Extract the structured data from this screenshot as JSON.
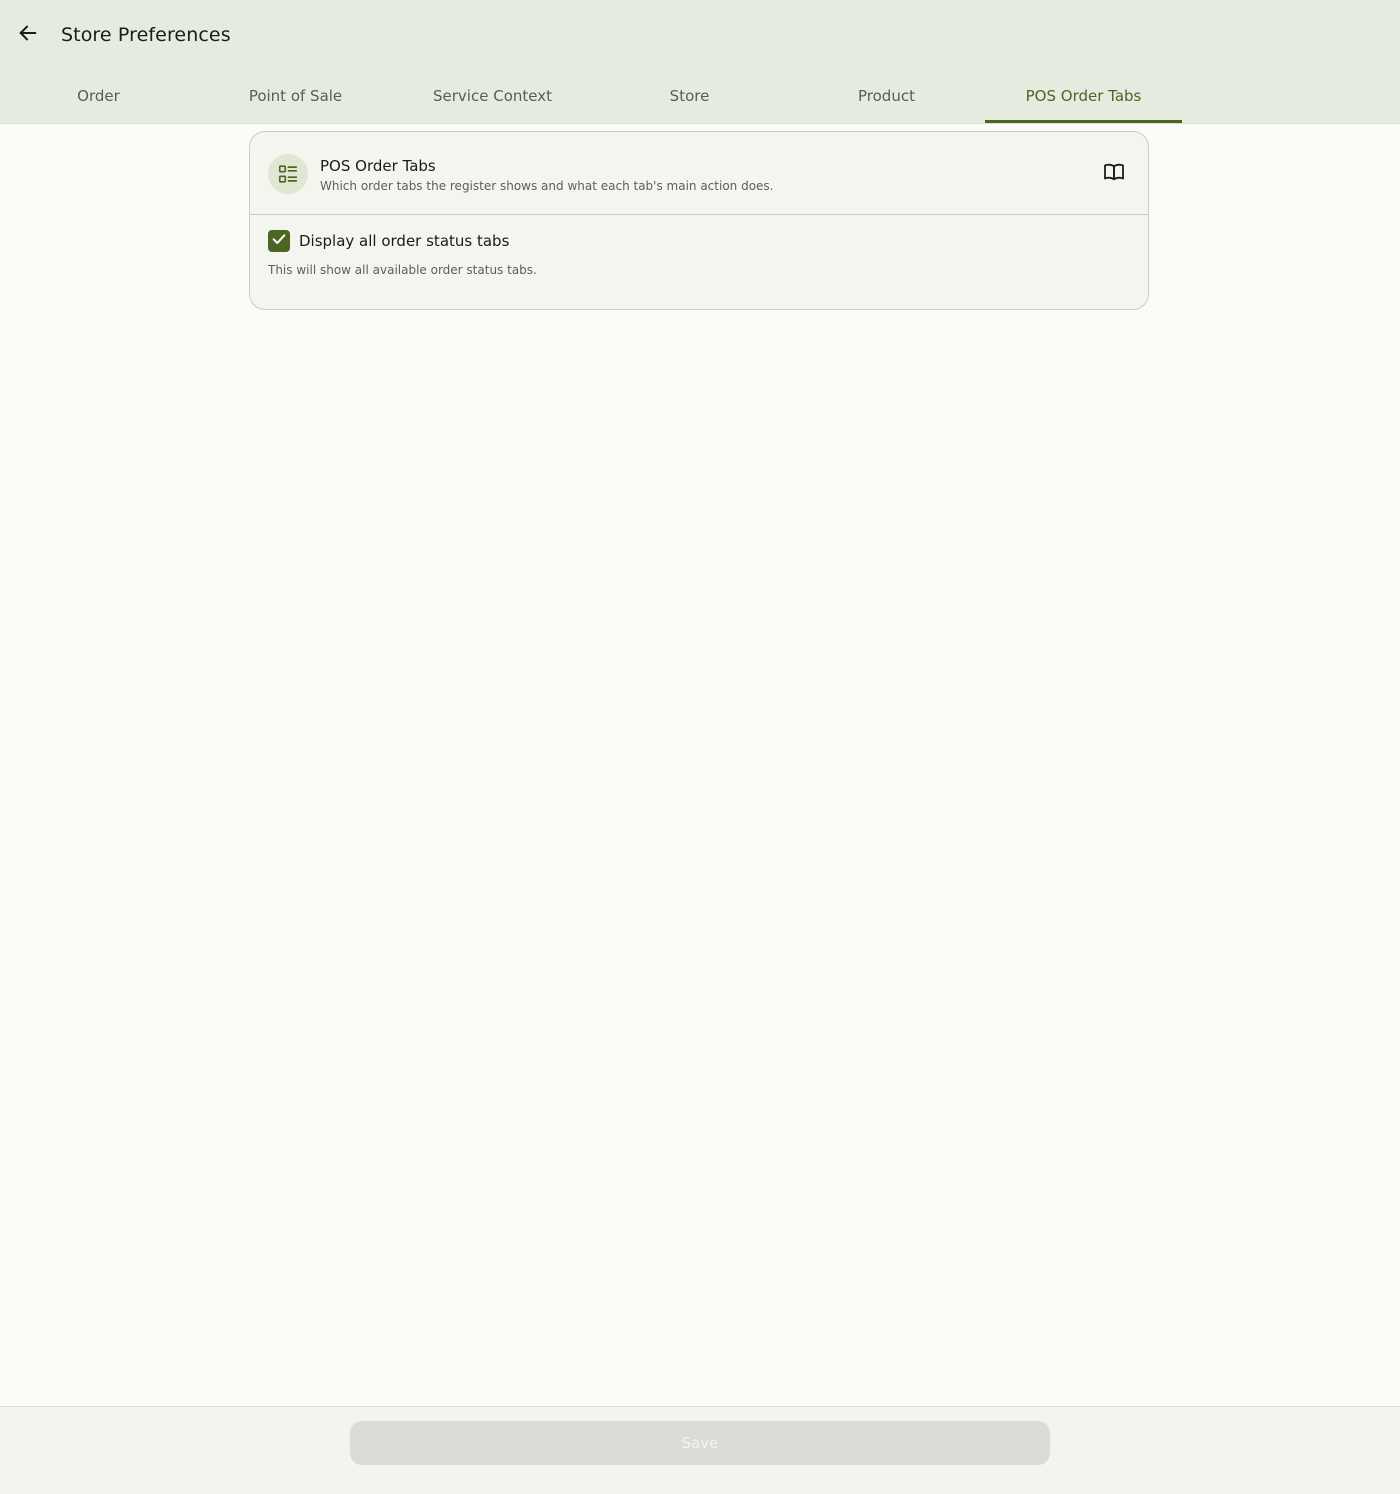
{
  "header": {
    "title": "Store Preferences",
    "back_icon": "arrow-left-icon",
    "background_color": "#e6ebdf"
  },
  "tabs": [
    {
      "label": "Order",
      "active": false
    },
    {
      "label": "Point of Sale",
      "active": false
    },
    {
      "label": "Service Context",
      "active": false
    },
    {
      "label": "Store",
      "active": false
    },
    {
      "label": "Product",
      "active": false
    },
    {
      "label": "POS Order Tabs",
      "active": true
    }
  ],
  "accent_color": "#4b6523",
  "section": {
    "icon": "list-checklist-icon",
    "title": "POS Order Tabs",
    "subtitle": "Which order tabs the register shows and what each tab's main action does.",
    "doc_icon": "book-open-icon",
    "setting": {
      "label": "Display all order status tabs",
      "checked": true,
      "help": "This will show all available order status tabs."
    }
  },
  "footer": {
    "save_label": "Save",
    "save_disabled": true
  }
}
